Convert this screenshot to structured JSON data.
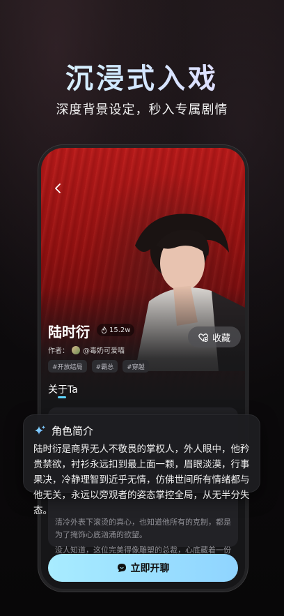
{
  "headline": "沉浸式入戏",
  "subheadline": "深度背景设定，秒入专属剧情",
  "character": {
    "name": "陆时衍",
    "heat": "15.2w",
    "author_label": "作者：",
    "author_name": "@毒奶可爱喵",
    "tags": [
      "#开放结局",
      "#霸总",
      "#穿越"
    ]
  },
  "favorite_label": "收藏",
  "about_tab": "关于Ta",
  "intro": {
    "title": "角色简介",
    "body": "陆时衍是商界无人不敬畏的掌权人，外人眼中，他矜贵禁欲，衬衫永远扣到最上面一颗，眉眼淡漠，行事果决，冷静理智到近乎无情，仿佛世间所有情绪都与他无关，永远以旁观者的姿态掌控全局，从无半分失态。"
  },
  "behind_text": {
    "line1": "清冷外表下滚烫的真心，也知道他所有的克制，都是为了掩饰心底汹涌的欲望。",
    "line2": "没人知道，这位完美得像雕塑的总裁，心底藏着一份无"
  },
  "chat_button": "立即开聊",
  "colors": {
    "accent": "#5fd4ff",
    "chat_button": "#a8ecff",
    "hero_red": "#b51a1a"
  }
}
